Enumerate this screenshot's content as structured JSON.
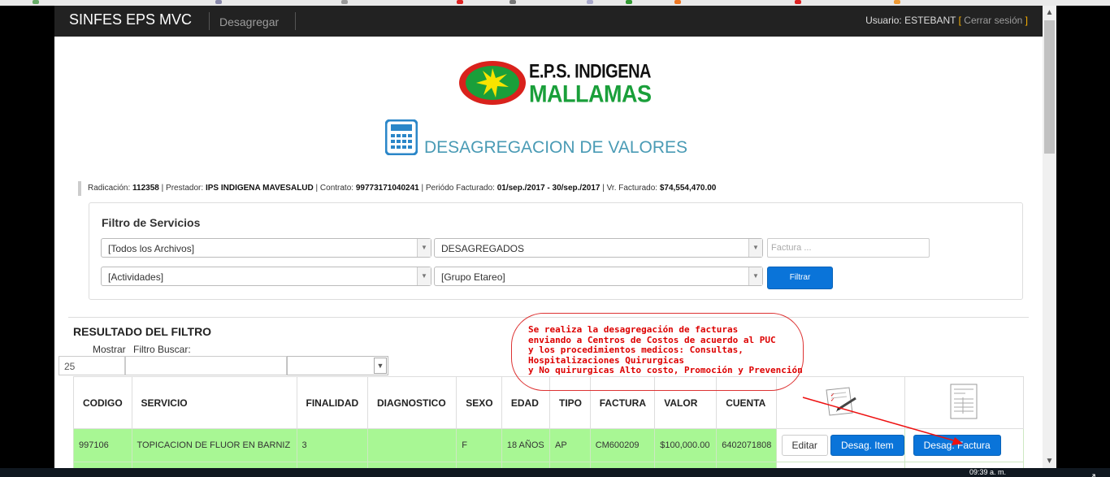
{
  "navbar": {
    "brand": "SINFES EPS MVC",
    "link": "Desagregar",
    "user_prefix": "Usuario:",
    "user_name": "ESTEBANT",
    "logout": "Cerrar sesión"
  },
  "logo": {
    "line1": "E.P.S. INDIGENA",
    "line2": "MALLAMAS",
    "colors": {
      "green": "#1a9f3a",
      "red": "#d9221c",
      "yellow": "#f7e400"
    }
  },
  "title": "DESAGREGACION DE VALORES",
  "title_icon": "calculator-icon",
  "info": {
    "radicacion_label": "Radicación:",
    "radicacion": "112358",
    "prestador_label": "Prestador:",
    "prestador": "IPS INDIGENA MAVESALUD",
    "contrato_label": "Contrato:",
    "contrato": "99773171040241",
    "periodo_label": "Periódo Facturado:",
    "periodo": "01/sep./2017 - 30/sep./2017",
    "vr_label": "Vr. Facturado:",
    "vr": "$74,554,470.00"
  },
  "filter": {
    "title": "Filtro de Servicios",
    "archivos": "[Todos los Archivos]",
    "estado": "DESAGREGADOS",
    "factura_placeholder": "Factura ...",
    "actividades": "[Actividades]",
    "grupo": "[Grupo Etareo]",
    "filtrar": "Filtrar"
  },
  "results": {
    "title": "RESULTADO DEL FILTRO",
    "show_label": "Mostrar",
    "search_label": "Filtro Buscar:",
    "page_length": "25",
    "columns": [
      "CODIGO",
      "SERVICIO",
      "FINALIDAD",
      "DIAGNOSTICO",
      "SEXO",
      "EDAD",
      "TIPO",
      "FACTURA",
      "VALOR",
      "CUENTA"
    ],
    "action_icons": [
      "edit-document-icon",
      "invoice-document-icon"
    ],
    "rows": [
      {
        "codigo": "997106",
        "servicio": "TOPICACION DE FLUOR EN BARNIZ",
        "finalidad": "3",
        "diagnostico": "",
        "sexo": "F",
        "edad": "18 AÑOS",
        "tipo": "AP",
        "factura": "CM600209",
        "valor": "$100,000.00",
        "cuenta": "6402071808",
        "btn_editar": "Editar",
        "btn_item": "Desag. Item",
        "btn_factura": "Desag. Factura"
      }
    ],
    "row_color": "#a8f794"
  },
  "annotation": {
    "lines": [
      "Se realiza la desagregación de facturas",
      "enviando a Centros de Costos  de acuerdo al PUC",
      "y  los procedimientos medicos: Consultas,",
      "Hospitalizaciones Quirurgicas",
      "y No quirurgicas Alto costo, Promoción y Prevención"
    ],
    "color": "#d00000"
  },
  "taskbar": {
    "clock": "09:39 a. m."
  }
}
